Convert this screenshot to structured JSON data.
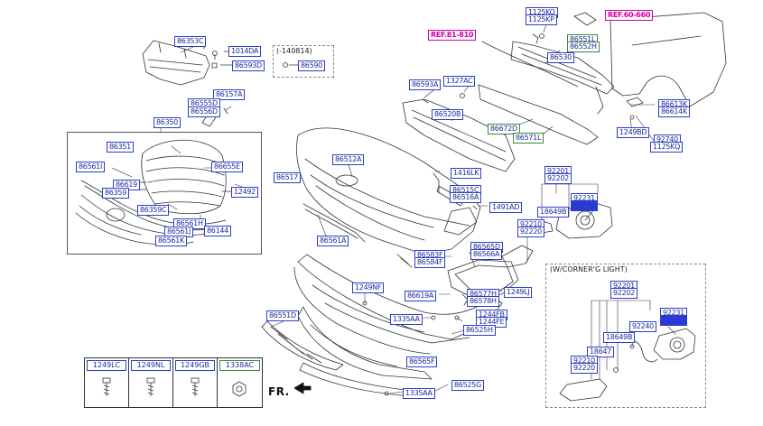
{
  "labels": [
    {
      "id": "l01",
      "text": "86353C"
    },
    {
      "id": "l02",
      "text": "1014DA"
    },
    {
      "id": "l03",
      "text": "86593D"
    },
    {
      "id": "l04",
      "text": "86590"
    },
    {
      "id": "l05",
      "text": "(-140814)"
    },
    {
      "id": "l06",
      "text": "86157A"
    },
    {
      "id": "l07",
      "text": "86555D"
    },
    {
      "id": "l08",
      "text": "86556D"
    },
    {
      "id": "l09",
      "text": "86350"
    },
    {
      "id": "l10",
      "text": "86351"
    },
    {
      "id": "l11",
      "text": "86655E"
    },
    {
      "id": "l12",
      "text": "86561I"
    },
    {
      "id": "l13",
      "text": "86619"
    },
    {
      "id": "l14",
      "text": "86359"
    },
    {
      "id": "l15",
      "text": "12492"
    },
    {
      "id": "l16",
      "text": "86359C"
    },
    {
      "id": "l17",
      "text": "86561H"
    },
    {
      "id": "l18",
      "text": "86561J"
    },
    {
      "id": "l19",
      "text": "86144"
    },
    {
      "id": "l20",
      "text": "86561K"
    },
    {
      "id": "l21",
      "text": "1125KO"
    },
    {
      "id": "l22",
      "text": "1125KP"
    },
    {
      "id": "l23",
      "text": "REF.60-660"
    },
    {
      "id": "l24",
      "text": "REF.81-810"
    },
    {
      "id": "l25",
      "text": "86551L"
    },
    {
      "id": "l26",
      "text": "86552H"
    },
    {
      "id": "l27",
      "text": "86530"
    },
    {
      "id": "l28",
      "text": "1327AC"
    },
    {
      "id": "l29",
      "text": "86593A"
    },
    {
      "id": "l30",
      "text": "86520B"
    },
    {
      "id": "l31",
      "text": "86672D"
    },
    {
      "id": "l32",
      "text": "86571L"
    },
    {
      "id": "l33",
      "text": "86613K"
    },
    {
      "id": "l34",
      "text": "86614K"
    },
    {
      "id": "l35",
      "text": "1249BD"
    },
    {
      "id": "l36",
      "text": "92740"
    },
    {
      "id": "l37",
      "text": "1125KQ"
    },
    {
      "id": "l38",
      "text": "86512A"
    },
    {
      "id": "l39",
      "text": "86517"
    },
    {
      "id": "l40",
      "text": "1416LK"
    },
    {
      "id": "l41",
      "text": "86515C"
    },
    {
      "id": "l42",
      "text": "86516A"
    },
    {
      "id": "l43",
      "text": "1491AD"
    },
    {
      "id": "l44",
      "text": "92201"
    },
    {
      "id": "l45",
      "text": "92202"
    },
    {
      "id": "l46",
      "text": "92231"
    },
    {
      "id": "l47",
      "text": "92232"
    },
    {
      "id": "l48",
      "text": "18649B"
    },
    {
      "id": "l49",
      "text": "92210"
    },
    {
      "id": "l50",
      "text": "92220"
    },
    {
      "id": "l51",
      "text": "86561A"
    },
    {
      "id": "l52",
      "text": "86565D"
    },
    {
      "id": "l53",
      "text": "86566A"
    },
    {
      "id": "l54",
      "text": "86583F"
    },
    {
      "id": "l55",
      "text": "86584F"
    },
    {
      "id": "l56",
      "text": "1249NF"
    },
    {
      "id": "l57",
      "text": "86619A"
    },
    {
      "id": "l58",
      "text": "86577H"
    },
    {
      "id": "l59",
      "text": "86578H"
    },
    {
      "id": "l60",
      "text": "1249LJ"
    },
    {
      "id": "l61",
      "text": "1335AA"
    },
    {
      "id": "l62",
      "text": "1244FB"
    },
    {
      "id": "l63",
      "text": "1244FE"
    },
    {
      "id": "l64",
      "text": "86525H"
    },
    {
      "id": "l65",
      "text": "86551D"
    },
    {
      "id": "l66",
      "text": "86565F"
    },
    {
      "id": "l67",
      "text": "1335AA"
    },
    {
      "id": "l68",
      "text": "86525G"
    },
    {
      "id": "l69",
      "text": "(W/CORNER'G LIGHT)"
    },
    {
      "id": "l70",
      "text": "92201"
    },
    {
      "id": "l71",
      "text": "92202"
    },
    {
      "id": "l72",
      "text": "92231"
    },
    {
      "id": "l73",
      "text": "92232"
    },
    {
      "id": "l74",
      "text": "92240"
    },
    {
      "id": "l75",
      "text": "18649B"
    },
    {
      "id": "l76",
      "text": "18647"
    },
    {
      "id": "l77",
      "text": "92210"
    },
    {
      "id": "l78",
      "text": "92220"
    }
  ],
  "legend": [
    "1249LC",
    "1249NL",
    "1249GB",
    "1338AC"
  ],
  "direction_label": "FR."
}
